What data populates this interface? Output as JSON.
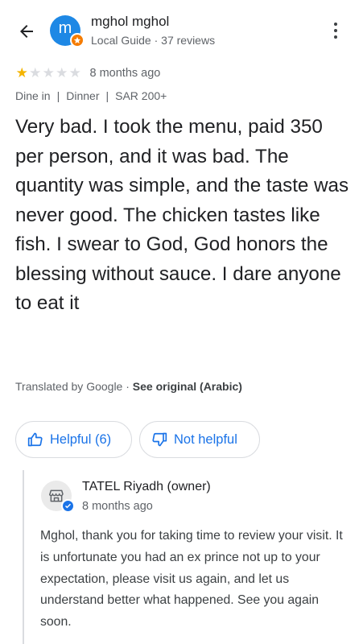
{
  "reviewer": {
    "avatar_letter": "m",
    "name": "mghol mghol",
    "meta": "Local Guide · 37 reviews"
  },
  "review": {
    "rating": 1,
    "max_rating": 5,
    "date": "8 months ago",
    "tags": [
      "Dine in",
      "Dinner",
      "SAR 200+"
    ],
    "text": "Very bad. I took the menu, paid 350 per person, and it was bad. The quantity was simple, and the taste was never good. The chicken tastes like fish. I swear to God, God honors the blessing without sauce. I dare anyone to eat it",
    "translated_prefix": "Translated by Google · ",
    "see_original": "See original (Arabic)"
  },
  "actions": {
    "helpful_label": "Helpful (6)",
    "not_helpful_label": "Not helpful"
  },
  "owner_reply": {
    "name": "TATEL Riyadh (owner)",
    "date": "8 months ago",
    "text": "Mghol, thank you for taking time to review your visit.  It is unfortunate you had an ex prince not up to your expectation, please visit us again, and let us understand better what happened. See you again soon."
  },
  "colors": {
    "accent": "#1a73e8",
    "star": "#f4b400",
    "avatar": "#1e88e5",
    "local_guide_badge": "#f57c00"
  },
  "icons": {
    "back": "arrow-left-icon",
    "more": "more-vert-icon",
    "helpful": "thumb-up-icon",
    "not_helpful": "thumb-down-icon",
    "owner_avatar": "storefront-icon",
    "verified": "verified-check-icon"
  }
}
